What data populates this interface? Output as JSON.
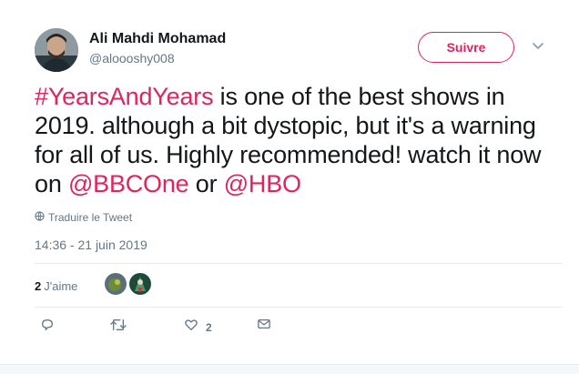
{
  "author": {
    "name": "Ali Mahdi Mohamad",
    "handle": "@aloooshy008"
  },
  "follow_button": {
    "label": "Suivre"
  },
  "tweet": {
    "segments": [
      {
        "text": "#YearsAndYears",
        "type": "link"
      },
      {
        "text": " is one of the best shows in 2019. although a bit dystopic, but it's a warning for all of us. Highly recommended! watch it now on ",
        "type": "text"
      },
      {
        "text": "@BBCOne",
        "type": "link"
      },
      {
        "text": " or ",
        "type": "text"
      },
      {
        "text": "@HBO",
        "type": "link"
      }
    ]
  },
  "translate": {
    "label": "Traduire le Tweet",
    "icon": "globe-icon"
  },
  "timestamp": "14:36 - 21 juin 2019",
  "stats": {
    "likes_count": "2",
    "likes_label": "J'aime"
  },
  "actions": {
    "reply": {
      "icon": "reply-icon"
    },
    "retweet": {
      "icon": "retweet-icon"
    },
    "like": {
      "icon": "heart-icon",
      "count": "2"
    },
    "message": {
      "icon": "envelope-icon"
    }
  },
  "colors": {
    "accent": "#e0245e",
    "secondary_text": "#657786",
    "primary_text": "#14171a",
    "divider": "#e6ecf0"
  }
}
